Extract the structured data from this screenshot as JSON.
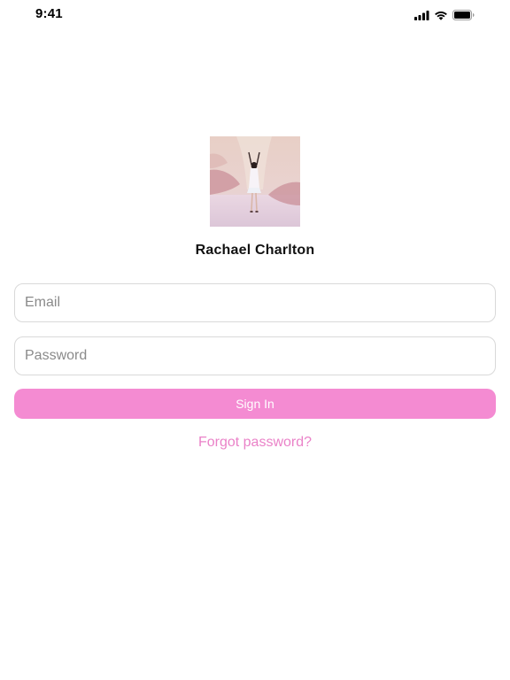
{
  "status_bar": {
    "time": "9:41",
    "icons": [
      "cellular-signal-icon",
      "wifi-icon",
      "battery-icon"
    ]
  },
  "profile": {
    "name": "Rachael Charlton",
    "avatar": "profile-photo"
  },
  "form": {
    "email_placeholder": "Email",
    "email_value": "",
    "password_placeholder": "Password",
    "password_value": "",
    "sign_in_label": "Sign In",
    "forgot_label": "Forgot password?"
  },
  "colors": {
    "accent": "#f48bd2",
    "link": "#ea82c8",
    "field_border": "#d9d9d9",
    "placeholder": "#8a8a8a"
  }
}
